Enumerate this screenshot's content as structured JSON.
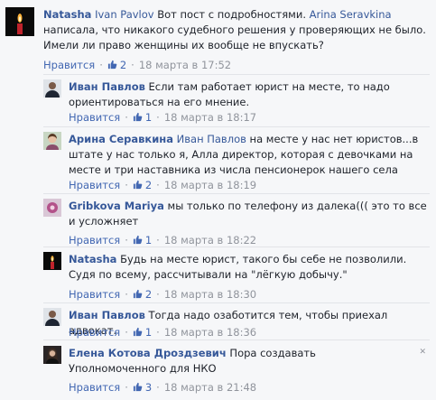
{
  "comments": [
    {
      "author": "Natasha",
      "mention1": "Ivan Pavlov",
      "text1": " Вот пост с подробностями. ",
      "mention2": "Arina Seravkina",
      "text2": " написала, что никакого судебного решения у проверяющих не было. Имели ли право женщины их вообще не впускать?",
      "like_label": "Нравится",
      "likes": "2",
      "time": "18 марта в 17:52",
      "avatar": "candle-avatar"
    },
    {
      "author": "Иван Павлов",
      "text1": " Если там работает юрист на месте, то надо ориентироваться на его мнение.",
      "like_label": "Нравится",
      "likes": "1",
      "time": "18 марта в 18:17",
      "avatar": "man-portrait-avatar"
    },
    {
      "author": "Арина Серавкина",
      "mention1": "Иван Павлов",
      "text1": " на месте у нас нет юристов...в штате у нас только я, Алла директор, которая с девочками на месте и три наставника из числа пенсионерок нашего села",
      "like_label": "Нравится",
      "likes": "2",
      "time": "18 марта в 18:19",
      "avatar": "woman-portrait-avatar"
    },
    {
      "author": "Gribkova Mariya",
      "text1": " мы только по телефону из далека((( это то все и усложняет",
      "like_label": "Нравится",
      "likes": "1",
      "time": "18 марта в 18:22",
      "avatar": "flower-avatar"
    },
    {
      "author": "Natasha",
      "text1": " Будь на месте юрист, такого бы себе не позволили. Судя по всему, рассчитывали на \"лёгкую добычу.\"",
      "like_label": "Нравится",
      "likes": "2",
      "time": "18 марта в 18:30",
      "avatar": "candle-avatar"
    },
    {
      "author": "Иван Павлов",
      "text1": " Тогда надо озаботится тем, чтобы приехал адвокат.",
      "like_label": "Нравится",
      "likes": "1",
      "time": "18 марта в 18:36",
      "avatar": "man-portrait-avatar"
    },
    {
      "author": "Елена Котова Дроздзевич",
      "text1": " Пора создавать Уполномоченного для НКО",
      "like_label": "Нравится",
      "likes": "3",
      "time": "18 марта в 21:48",
      "avatar": "woman-dark-avatar"
    }
  ],
  "close_glyph": "✕",
  "sep": "·"
}
